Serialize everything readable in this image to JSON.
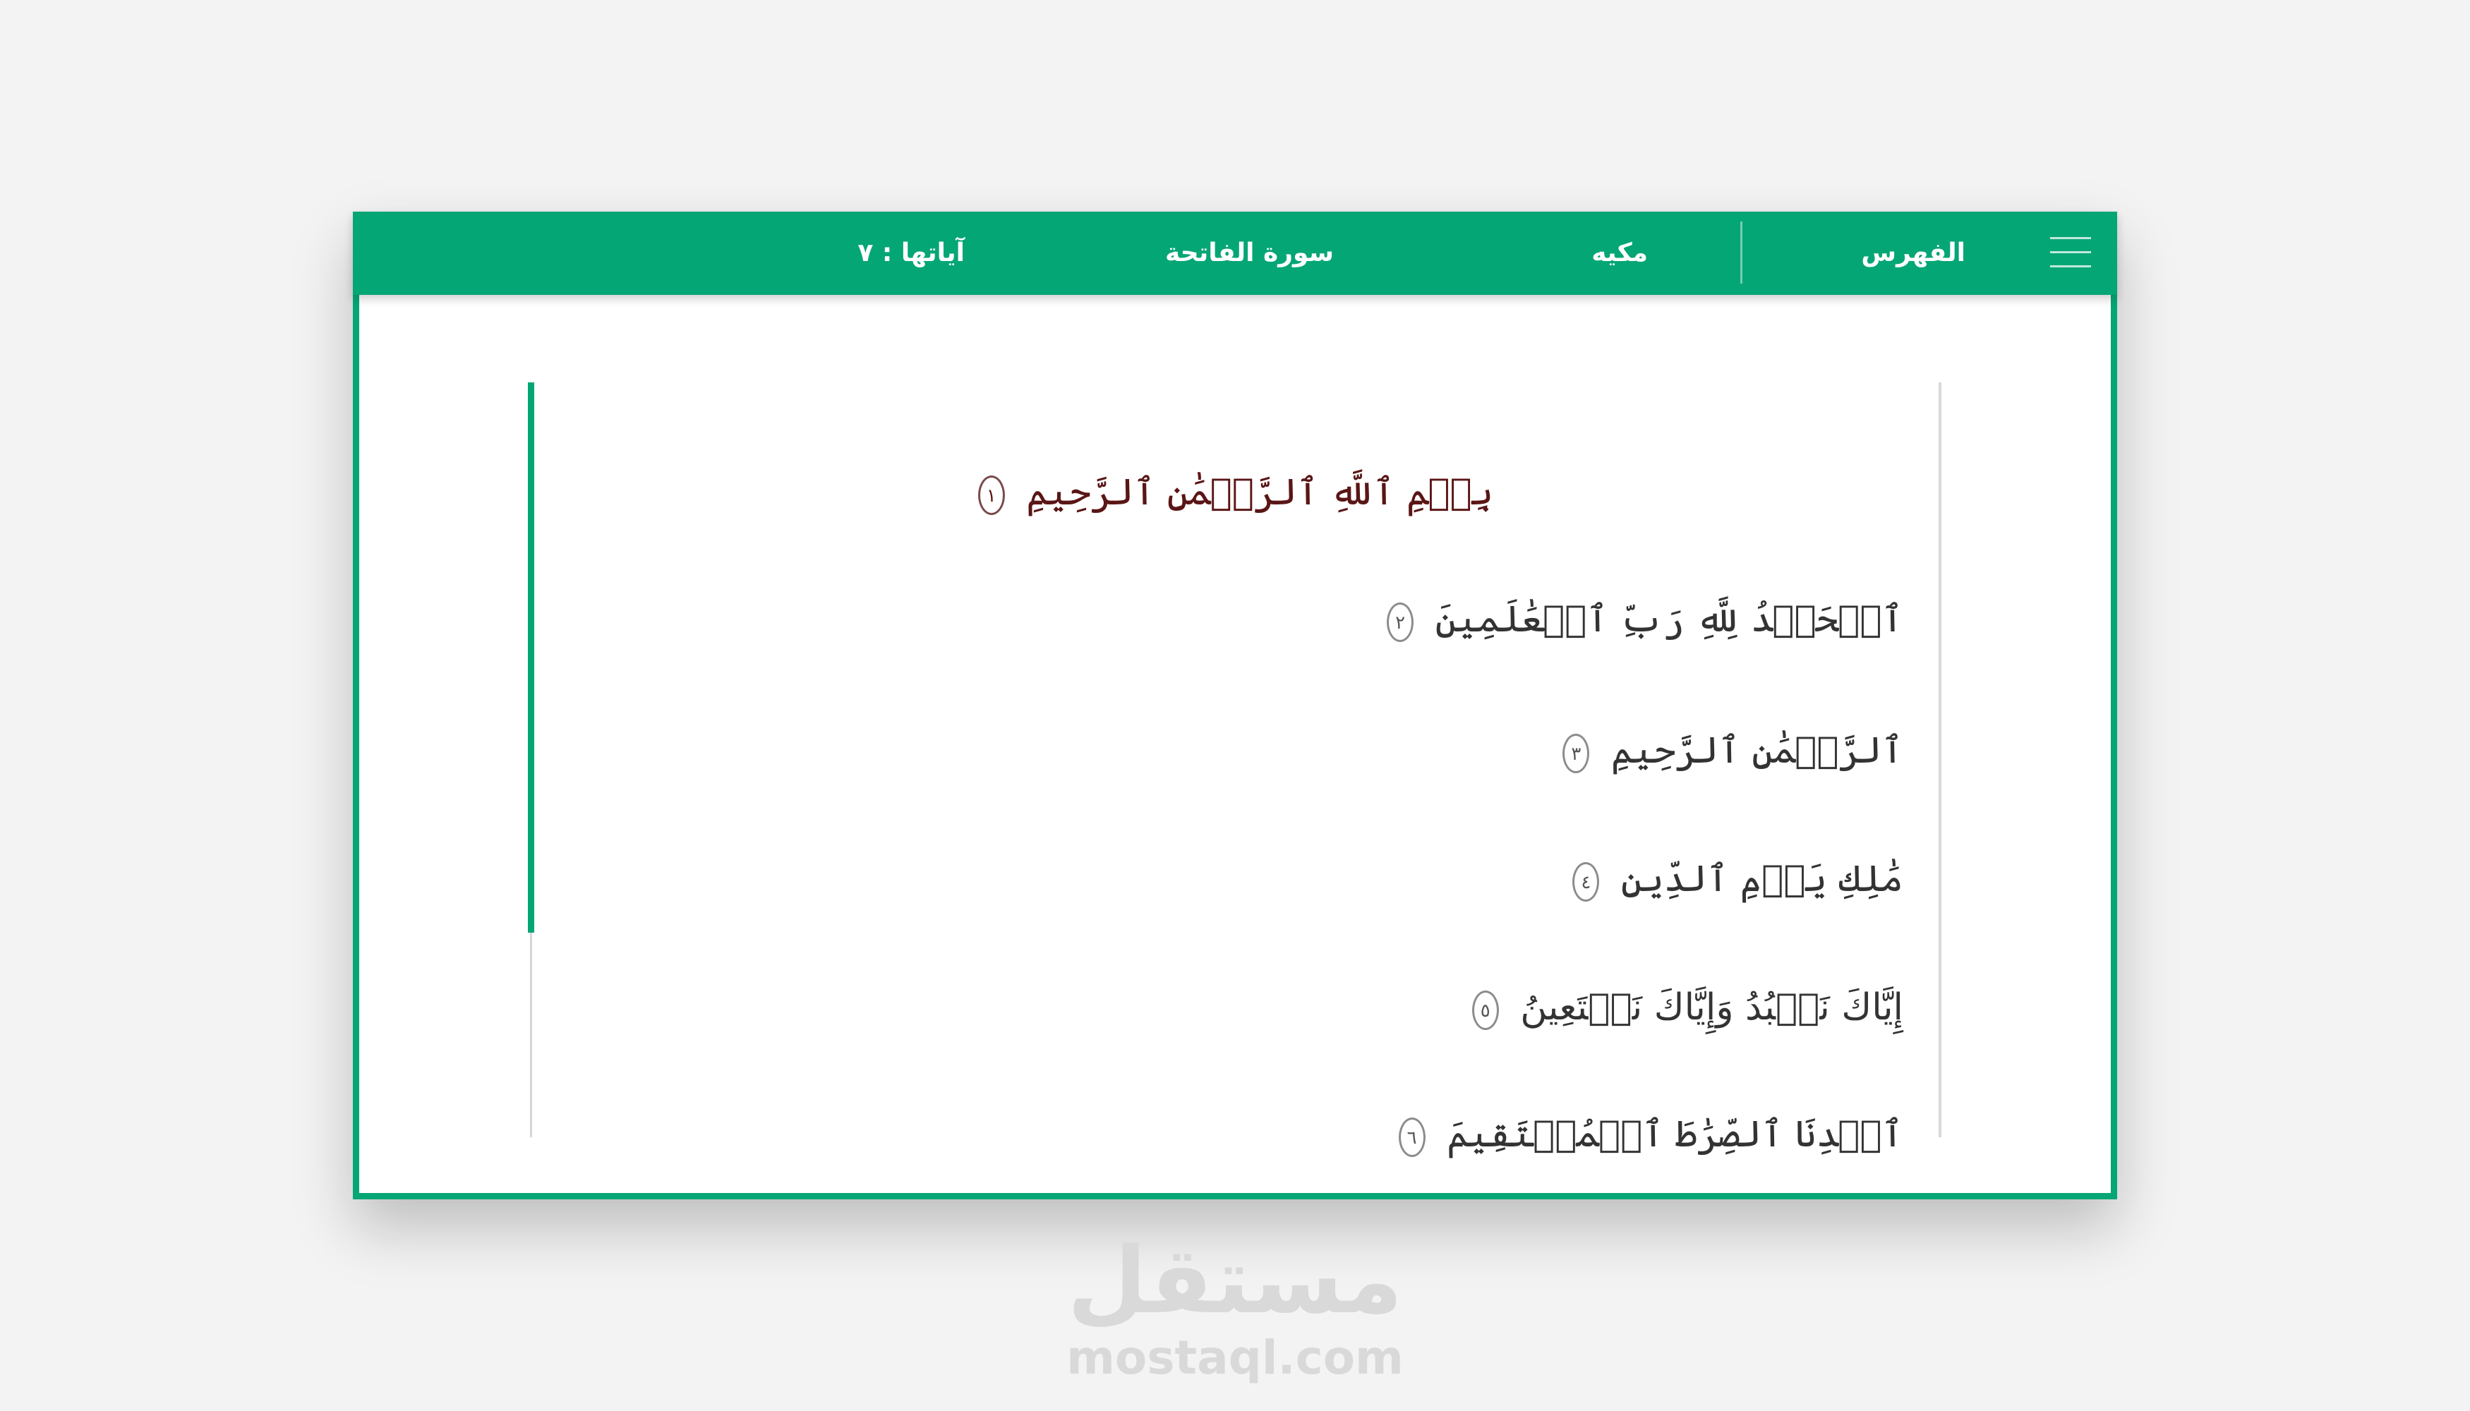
{
  "header": {
    "menu_icon": "hamburger-icon",
    "index_label": "الفهرس",
    "revelation_type": "مكيه",
    "surah_name": "سورة الفاتحة",
    "verse_count": "آياتها : ٧"
  },
  "reader": {
    "basmala": {
      "text": "بِسۡمِ ٱللَّهِ ٱلرَّحۡمَٰنِ ٱلرَّحِيمِ",
      "number": "١"
    },
    "verses": [
      {
        "text": "ٱلۡحَمۡدُ لِلَّهِ رَبِّ ٱلۡعَٰلَمِينَ",
        "number": "٢"
      },
      {
        "text": "ٱلرَّحۡمَٰنِ ٱلرَّحِيمِ",
        "number": "٣"
      },
      {
        "text": "مَٰلِكِ يَوۡمِ ٱلدِّينِ",
        "number": "٤"
      },
      {
        "text": "إِيَّاكَ نَعۡبُدُ وَإِيَّاكَ نَسۡتَعِينُ",
        "number": "٥"
      },
      {
        "text": "ٱهۡدِنَا ٱلصِّرَٰطَ ٱلۡمُسۡتَقِيمَ",
        "number": "٦"
      }
    ]
  },
  "watermark": {
    "logo_text": "مستقل",
    "url": "mostaql.com"
  },
  "colors": {
    "accent": "#05a675",
    "basmala_text": "#5a1515",
    "verse_text": "#333333",
    "background": "#f3f3f3"
  }
}
